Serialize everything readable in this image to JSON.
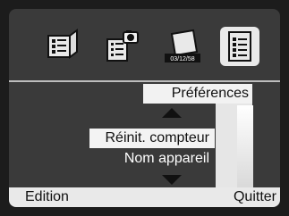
{
  "tabs": {
    "items": [
      {
        "id": "tab-1",
        "icon": "document-list-icon"
      },
      {
        "id": "tab-2",
        "icon": "camera-settings-icon"
      },
      {
        "id": "tab-3",
        "icon": "date-time-icon",
        "label": "03/12/58"
      },
      {
        "id": "tab-4",
        "icon": "preferences-checklist-icon",
        "active": true
      }
    ]
  },
  "header": {
    "title": "Préférences"
  },
  "menu": {
    "items": [
      {
        "label": "Réinit. compteur",
        "selected": true
      },
      {
        "label": "Nom appareil",
        "selected": false
      }
    ]
  },
  "bottom": {
    "left": "Edition",
    "right": "Quitter"
  },
  "colors": {
    "background": "#3a3a3a",
    "selected": "#f3f3f3",
    "header": "#f2f2f2",
    "text_dark": "#111111"
  }
}
